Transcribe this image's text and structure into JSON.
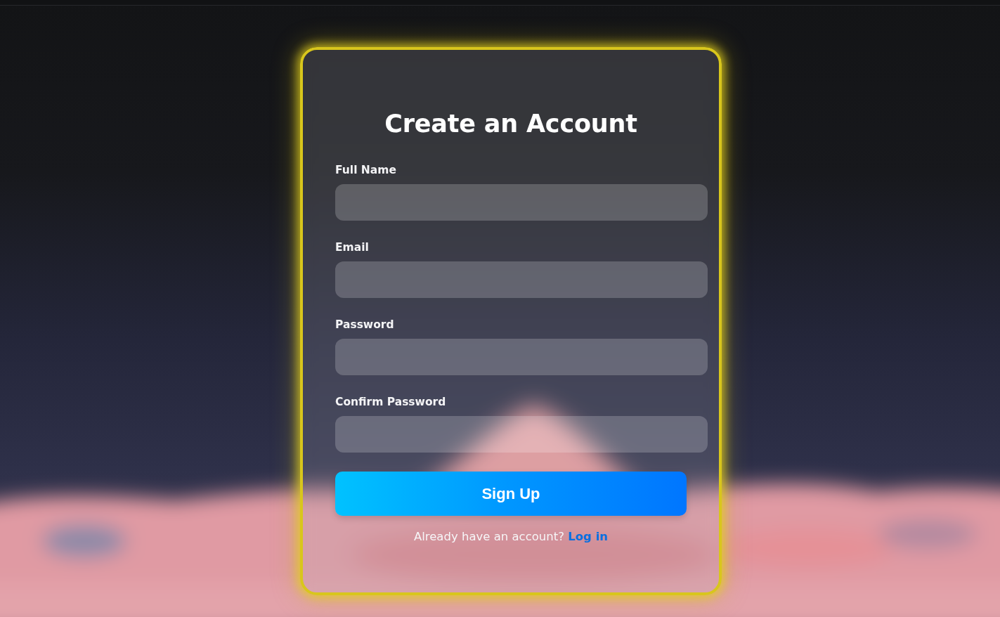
{
  "card": {
    "title": "Create an Account"
  },
  "fields": [
    {
      "label": "Full Name"
    },
    {
      "label": "Email"
    },
    {
      "label": "Password"
    },
    {
      "label": "Confirm Password"
    }
  ],
  "submit_button": {
    "label": "Sign Up"
  },
  "footer": {
    "text": "Already have an account?",
    "link": "Log in"
  }
}
